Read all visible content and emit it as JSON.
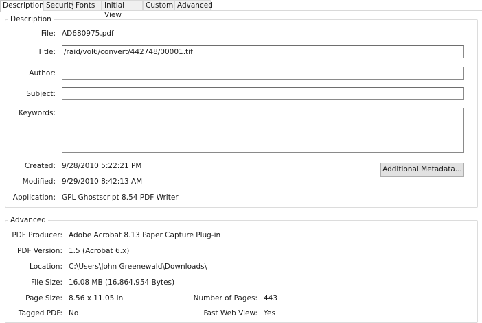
{
  "tabs": [
    {
      "label": "Description",
      "active": true
    },
    {
      "label": "Security"
    },
    {
      "label": "Fonts"
    },
    {
      "label": "Initial View"
    },
    {
      "label": "Custom"
    },
    {
      "label": "Advanced"
    }
  ],
  "description": {
    "legend": "Description",
    "file_label": "File:",
    "file_value": "AD680975.pdf",
    "title_label": "Title:",
    "title_value": "/raid/vol6/convert/442748/00001.tif",
    "author_label": "Author:",
    "author_value": "",
    "subject_label": "Subject:",
    "subject_value": "",
    "keywords_label": "Keywords:",
    "keywords_value": "",
    "created_label": "Created:",
    "created_value": "9/28/2010 5:22:21 PM",
    "modified_label": "Modified:",
    "modified_value": "9/29/2010 8:42:13 AM",
    "application_label": "Application:",
    "application_value": "GPL Ghostscript 8.54 PDF Writer",
    "metadata_button": "Additional Metadata..."
  },
  "advanced": {
    "legend": "Advanced",
    "producer_label": "PDF Producer:",
    "producer_value": "Adobe Acrobat 8.13 Paper Capture Plug-in",
    "version_label": "PDF Version:",
    "version_value": "1.5 (Acrobat 6.x)",
    "location_label": "Location:",
    "location_value": "C:\\Users\\John Greenewald\\Downloads\\",
    "filesize_label": "File Size:",
    "filesize_value": "16.08 MB (16,864,954 Bytes)",
    "pagesize_label": "Page Size:",
    "pagesize_value": "8.56 x 11.05 in",
    "pages_label": "Number of Pages:",
    "pages_value": "443",
    "tagged_label": "Tagged PDF:",
    "tagged_value": "No",
    "fastweb_label": "Fast Web View:",
    "fastweb_value": "Yes"
  }
}
